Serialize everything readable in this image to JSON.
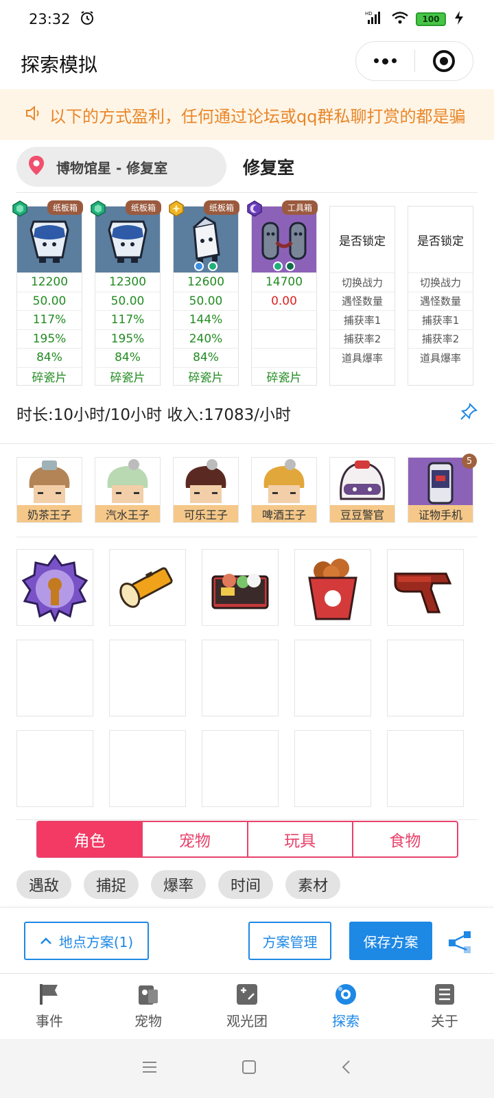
{
  "status": {
    "time": "23:32",
    "battery": "100"
  },
  "header": {
    "title": "探索模拟"
  },
  "notice": {
    "text": "以下的方式盈利，任何通过论坛或qq群私聊打赏的都是骗"
  },
  "location": {
    "pill": "博物馆星 - 修复室",
    "title": "修复室"
  },
  "cards": [
    {
      "tag": "纸板箱",
      "power": "12200",
      "count": "50.00",
      "cap1": "117%",
      "cap2": "195%",
      "drop": "84%",
      "item": "碎瓷片"
    },
    {
      "tag": "纸板箱",
      "power": "12300",
      "count": "50.00",
      "cap1": "117%",
      "cap2": "195%",
      "drop": "84%",
      "item": "碎瓷片"
    },
    {
      "tag": "纸板箱",
      "power": "12600",
      "count": "50.00",
      "cap1": "144%",
      "cap2": "240%",
      "drop": "84%",
      "item": "碎瓷片"
    },
    {
      "tag": "工具箱",
      "power": "14700",
      "count": "0.00",
      "cap1": "",
      "cap2": "",
      "drop": "",
      "item": "碎瓷片"
    }
  ],
  "label_card": {
    "lock": "是否锁定",
    "power": "切换战力",
    "count": "遇怪数量",
    "cap1": "捕获率1",
    "cap2": "捕获率2",
    "drop": "道具爆率"
  },
  "duration": {
    "text": "时长:10小时/10小时 收入:17083/小时"
  },
  "pets": [
    {
      "name": "奶茶王子"
    },
    {
      "name": "汽水王子"
    },
    {
      "name": "可乐王子"
    },
    {
      "name": "啤酒王子"
    },
    {
      "name": "豆豆警官"
    },
    {
      "name": "证物手机",
      "count": "5"
    }
  ],
  "tabs": [
    "角色",
    "宠物",
    "玩具",
    "食物"
  ],
  "chips": [
    "遇敌",
    "捕捉",
    "爆率",
    "时间",
    "素材"
  ],
  "actions": {
    "location_plan": "地点方案(1)",
    "manage": "方案管理",
    "save": "保存方案"
  },
  "tabbar": [
    "事件",
    "宠物",
    "观光团",
    "探索",
    "关于"
  ],
  "colors": {
    "accent": "#f23a64",
    "primary": "#1e88e5",
    "notice": "#e8862a"
  }
}
